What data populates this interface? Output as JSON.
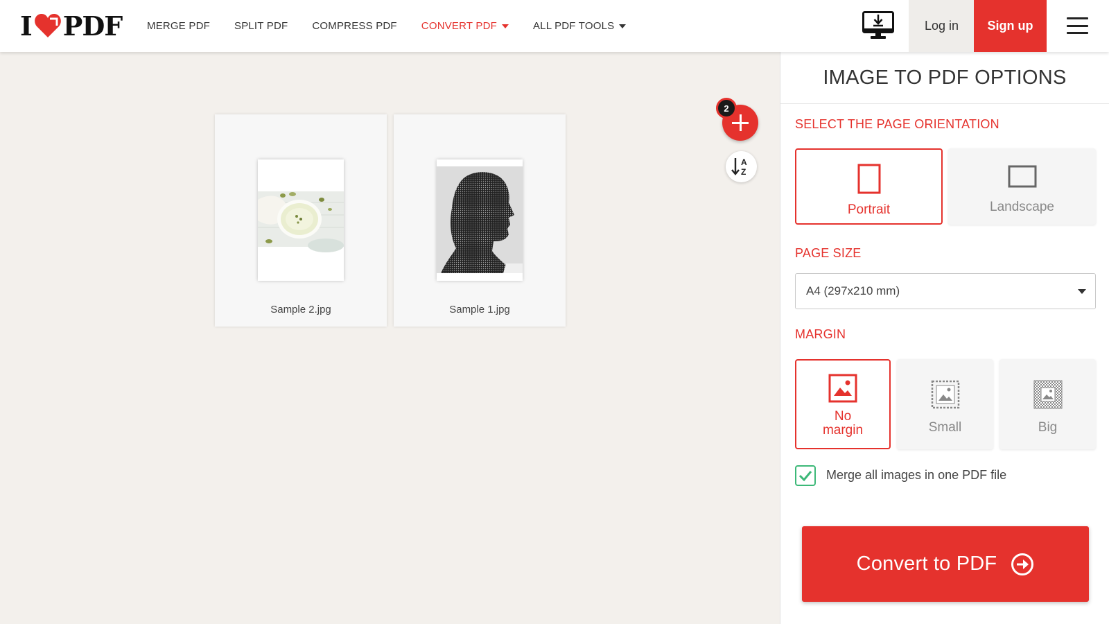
{
  "header": {
    "logo_prefix": "I",
    "logo_suffix": "PDF",
    "nav": [
      {
        "label": "MERGE PDF",
        "has_caret": false,
        "active": false
      },
      {
        "label": "SPLIT PDF",
        "has_caret": false,
        "active": false
      },
      {
        "label": "COMPRESS PDF",
        "has_caret": false,
        "active": false
      },
      {
        "label": "CONVERT PDF",
        "has_caret": true,
        "active": true
      },
      {
        "label": "ALL PDF TOOLS",
        "has_caret": true,
        "active": false
      }
    ],
    "desktop_icon": "desktop-download-icon",
    "login_label": "Log in",
    "signup_label": "Sign up",
    "menu_icon": "hamburger-menu-icon"
  },
  "workspace": {
    "files": [
      {
        "name": "Sample 2.jpg",
        "thumbnail": "soup-bowl-photo"
      },
      {
        "name": "Sample 1.jpg",
        "thumbnail": "wireframe-head-photo"
      }
    ],
    "file_count_badge": "2",
    "add_icon": "plus-icon",
    "sort_icon": "sort-az-icon"
  },
  "sidebar": {
    "title": "IMAGE TO PDF OPTIONS",
    "orientation_label": "SELECT THE PAGE ORIENTATION",
    "orientation_options": [
      {
        "label": "Portrait",
        "icon": "portrait-page-icon",
        "selected": true
      },
      {
        "label": "Landscape",
        "icon": "landscape-page-icon",
        "selected": false
      }
    ],
    "page_size_label": "PAGE SIZE",
    "page_size_value": "A4 (297x210 mm)",
    "margin_label": "MARGIN",
    "margin_options": [
      {
        "label": "No margin",
        "icon": "image-no-margin-icon",
        "selected": true
      },
      {
        "label": "Small",
        "icon": "image-small-margin-icon",
        "selected": false
      },
      {
        "label": "Big",
        "icon": "image-big-margin-icon",
        "selected": false
      }
    ],
    "merge_checkbox_checked": true,
    "merge_label": "Merge all images in one PDF file",
    "convert_label": "Convert to PDF",
    "convert_icon": "arrow-circle-right-icon"
  },
  "colors": {
    "brand_red": "#e5322d",
    "background": "#f3f0ec",
    "check_green": "#3cb878"
  }
}
